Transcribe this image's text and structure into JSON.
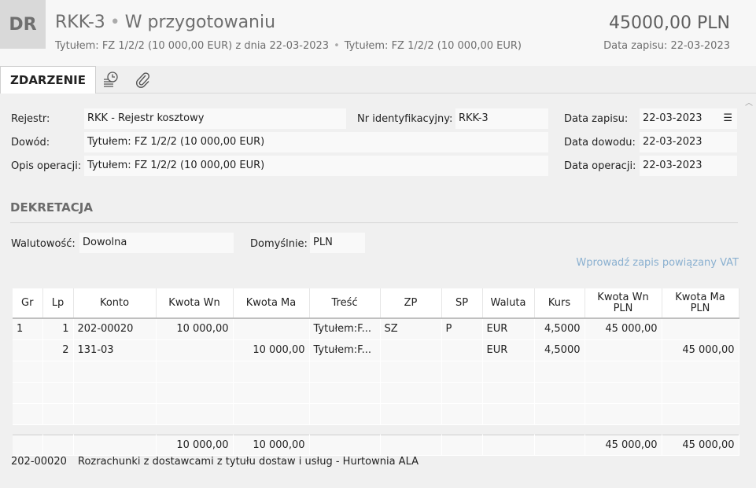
{
  "header": {
    "badge": "DR",
    "title_code": "RKK-3",
    "title_status": "W przygotowaniu",
    "subtitle_1": "Tytułem: FZ 1/2/2 (10 000,00 EUR) z dnia 22-03-2023",
    "subtitle_2": "Tytułem: FZ 1/2/2 (10 000,00 EUR)",
    "amount": "45000,00 PLN",
    "date_label": "Data zapisu: 22-03-2023"
  },
  "tabs": {
    "main": "ZDARZENIE",
    "history_icon": "history-icon",
    "attach_icon": "paperclip-icon"
  },
  "form": {
    "rejestr_label": "Rejestr:",
    "rejestr_value": "RKK - Rejestr kosztowy",
    "nr_label": "Nr identyfikacyjny:",
    "nr_value": "RKK-3",
    "data_zapisu_label": "Data zapisu:",
    "data_zapisu_value": "22-03-2023",
    "dowod_label": "Dowód:",
    "dowod_value": "Tytułem: FZ 1/2/2 (10 000,00 EUR)",
    "data_dowodu_label": "Data dowodu:",
    "data_dowodu_value": "22-03-2023",
    "opis_label": "Opis operacji:",
    "opis_value": "Tytułem: FZ 1/2/2 (10 000,00 EUR)",
    "data_operacji_label": "Data operacji:",
    "data_operacji_value": "22-03-2023"
  },
  "dekretacja": {
    "title": "DEKRETACJA",
    "walutowosc_label": "Walutowość:",
    "walutowosc_value": "Dowolna",
    "domyslnie_label": "Domyślnie:",
    "domyslnie_value": "PLN",
    "vat_link": "Wprowadź zapis powiązany VAT"
  },
  "table": {
    "headers": [
      "Gr",
      "Lp",
      "Konto",
      "Kwota Wn",
      "Kwota Ma",
      "Treść",
      "ZP",
      "SP",
      "Waluta",
      "Kurs",
      "Kwota Wn PLN",
      "Kwota Ma PLN"
    ],
    "rows": [
      [
        "1",
        "1",
        "202-00020",
        "10 000,00",
        "",
        "Tytułem:F...",
        "SZ",
        "P",
        "EUR",
        "4,5000",
        "45 000,00",
        ""
      ],
      [
        "",
        "2",
        "131-03",
        "",
        "10 000,00",
        "Tytułem:F...",
        "",
        "",
        "EUR",
        "4,5000",
        "",
        "45 000,00"
      ]
    ],
    "totals": [
      "",
      "",
      "",
      "10 000,00",
      "10 000,00",
      "",
      "",
      "",
      "",
      "",
      "45 000,00",
      "45 000,00"
    ]
  },
  "footer": {
    "account": "202-00020",
    "description": "Rozrachunki z dostawcami z tytułu dostaw i usług - Hurtownia ALA"
  }
}
